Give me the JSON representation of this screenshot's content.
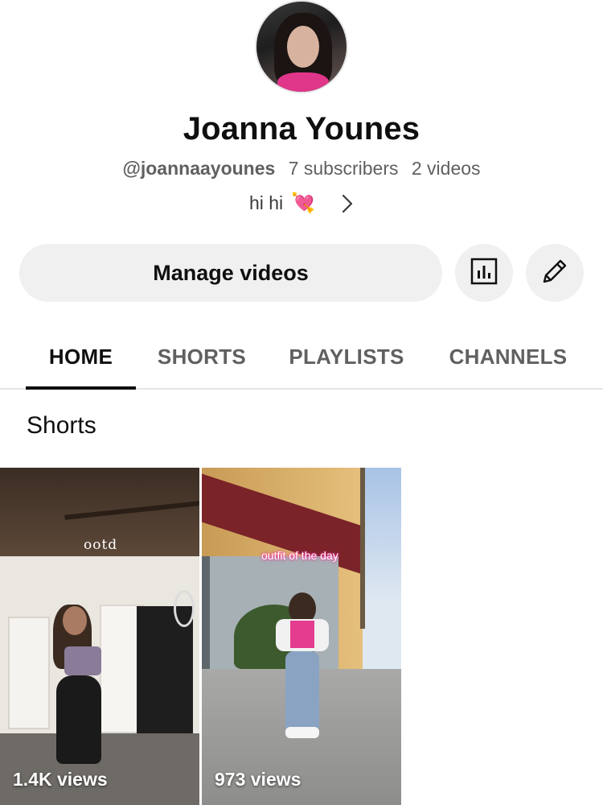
{
  "profile": {
    "name": "Joanna Younes",
    "handle": "@joannaayounes",
    "subscribers": "7 subscribers",
    "videos": "2 videos",
    "description": "hi hi",
    "description_emoji": "💘"
  },
  "actions": {
    "manage_label": "Manage videos",
    "analytics_icon": "analytics-icon",
    "edit_icon": "pencil-icon"
  },
  "tabs": [
    {
      "label": "HOME",
      "active": true
    },
    {
      "label": "SHORTS",
      "active": false
    },
    {
      "label": "PLAYLISTS",
      "active": false
    },
    {
      "label": "CHANNELS",
      "active": false
    }
  ],
  "section": {
    "title": "Shorts"
  },
  "shorts": [
    {
      "overlay": "ootd",
      "views": "1.4K views"
    },
    {
      "overlay": "outfit of the day",
      "views": "973 views"
    }
  ]
}
